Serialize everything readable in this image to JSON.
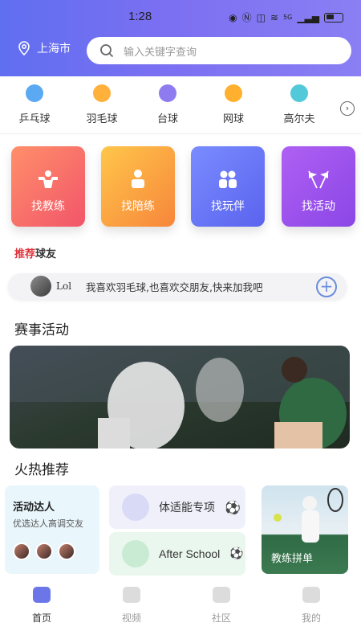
{
  "status_bar": {
    "time": "1:28",
    "network": "5G",
    "icons": [
      "eye-icon",
      "nfc-icon",
      "silent-icon",
      "wifi-icon",
      "signal-icon",
      "battery-icon"
    ]
  },
  "header": {
    "location": "上海市",
    "search_placeholder": "输入关键字查询"
  },
  "sports": [
    {
      "label": "乒乓球",
      "icon": "table-tennis-icon",
      "color": "#5aa9f2"
    },
    {
      "label": "羽毛球",
      "icon": "badminton-icon",
      "color": "#ffb13b"
    },
    {
      "label": "台球",
      "icon": "billiards-icon",
      "color": "#8f7bf0"
    },
    {
      "label": "网球",
      "icon": "tennis-icon",
      "color": "#ffb02e"
    },
    {
      "label": "高尔夫",
      "icon": "golf-icon",
      "color": "#52c9d9"
    }
  ],
  "features": [
    {
      "label": "找教练",
      "icon": "coach-icon"
    },
    {
      "label": "找陪练",
      "icon": "partner-icon"
    },
    {
      "label": "找玩伴",
      "icon": "playmate-icon"
    },
    {
      "label": "找活动",
      "icon": "flags-icon"
    }
  ],
  "recommend": {
    "title_red": "推荐",
    "title_rest": "球友",
    "friend_name": "Lol",
    "friend_message": "我喜欢羽毛球,也喜欢交朋友,快来加我吧"
  },
  "events_section": {
    "title": "赛事活动"
  },
  "hot_section": {
    "title": "火热推荐",
    "card_a": {
      "title": "活动达人",
      "subtitle": "优选达人高调交友"
    },
    "card_b1": {
      "label": "体适能专项"
    },
    "card_b2": {
      "label": "After School"
    },
    "card_c": {
      "label": "教练拼单"
    }
  },
  "tabbar": [
    {
      "label": "首页",
      "active": true
    },
    {
      "label": "视频",
      "active": false
    },
    {
      "label": "社区",
      "active": false
    },
    {
      "label": "我的",
      "active": false
    }
  ],
  "colors": {
    "header_start": "#5f6ff0",
    "header_end": "#8a7ff3",
    "accent": "#6b77e8"
  }
}
